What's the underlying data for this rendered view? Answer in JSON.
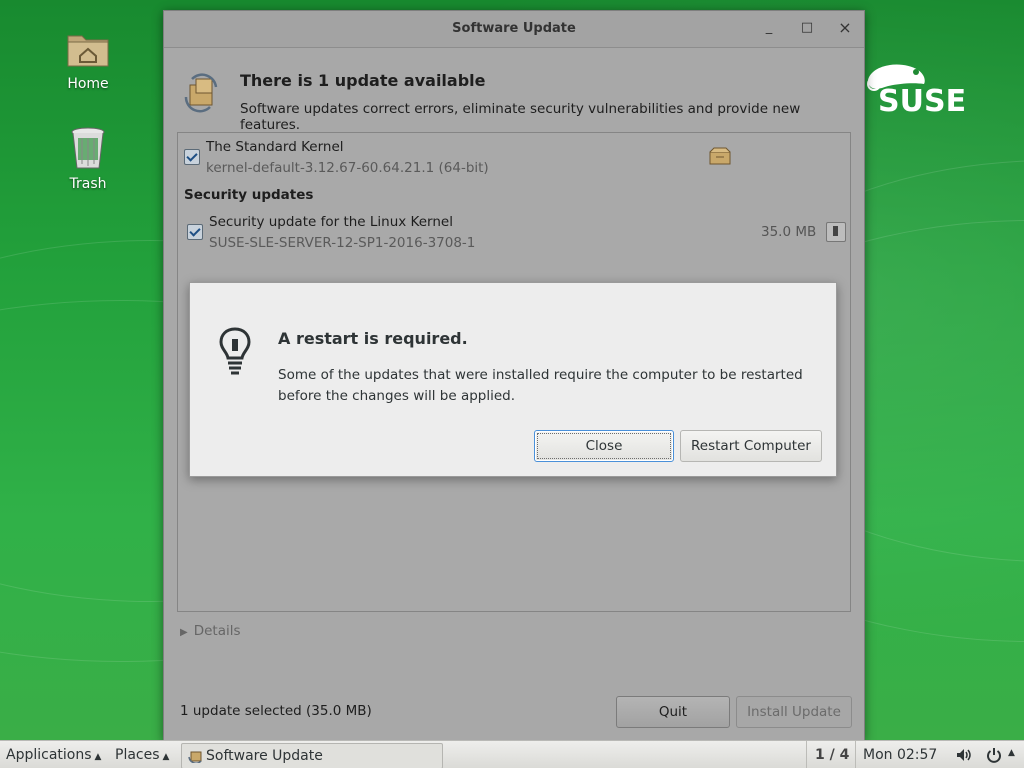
{
  "desktop": {
    "icons": [
      {
        "label": "Home"
      },
      {
        "label": "Trash"
      }
    ],
    "brand": "SUSE"
  },
  "window": {
    "title": "Software Update",
    "controls": {
      "minimize": "_",
      "maximize": "□",
      "close": "×"
    },
    "header": {
      "title": "There is 1 update available",
      "subtitle": "Software updates correct errors, eliminate security vulnerabilities and provide new features."
    },
    "updates": [
      {
        "name": "The Standard Kernel",
        "version": "kernel-default-3.12.67-60.64.21.1 (64-bit)",
        "checked": true
      }
    ],
    "security_section": "Security updates",
    "security_updates": [
      {
        "name": "Security update for the Linux Kernel",
        "version": "SUSE-SLE-SERVER-12-SP1-2016-3708-1",
        "size": "35.0 MB",
        "checked": true
      }
    ],
    "details_label": "Details",
    "status": "1 update selected (35.0 MB)",
    "quit_label": "Quit",
    "install_label": "Install Update"
  },
  "dialog": {
    "title": "A restart is required.",
    "body": "Some of the updates that were installed require the computer to be restarted before the changes will be applied.",
    "close_label": "Close",
    "restart_label": "Restart Computer"
  },
  "taskbar": {
    "applications": "Applications",
    "places": "Places",
    "task": "Software Update",
    "workspace": "1 / 4",
    "clock": "Mon 02:57"
  },
  "colors": {
    "desktop_green": "#2aa83f",
    "window_gray": "#a8a8a8",
    "dialog_bg": "#ededed",
    "focus_blue": "#4a90d9"
  }
}
